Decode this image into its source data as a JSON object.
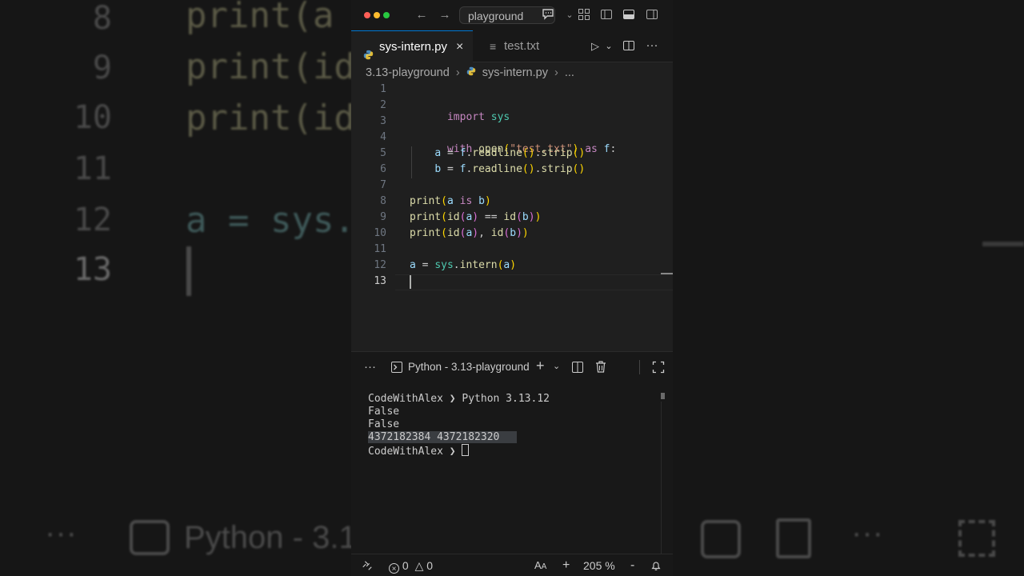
{
  "background": {
    "numbers": [
      "8",
      "9",
      "10",
      "11",
      "12",
      "13"
    ],
    "lines": [
      "print(a",
      "print(id",
      "print(id",
      "",
      "a = sys.",
      ""
    ],
    "bottom": {
      "dots": "···",
      "terminal": "Python - 3.1"
    }
  },
  "titlebar": {
    "search": "playground"
  },
  "tabs": [
    {
      "label": "sys-intern.py",
      "icon": "python-icon",
      "close": "×"
    },
    {
      "label": "test.txt",
      "icon": "text-file-icon"
    }
  ],
  "breadcrumb": {
    "folder": "3.13-playground",
    "file": "sys-intern.py",
    "more": "..."
  },
  "editor": {
    "line_numbers": [
      "1",
      "2",
      "3",
      "4",
      "5",
      "6",
      "7",
      "8",
      "9",
      "10",
      "11",
      "12",
      "13"
    ],
    "current_line": 13,
    "lines": [
      "",
      "import sys",
      "",
      "with open(\"test.txt\") as f:",
      "    a = f.readline().strip()",
      "    b = f.readline().strip()",
      "",
      "print(a is b)",
      "print(id(a) == id(b))",
      "print(id(a), id(b))",
      "",
      "a = sys.intern(a)",
      ""
    ]
  },
  "panel": {
    "more": "···",
    "terminal_name": "Python - 3.13-playground",
    "output": [
      "CodeWithAlex ❯ Python 3.13.12",
      "False",
      "False",
      "4372182384 4372182320",
      "CodeWithAlex ❯ "
    ]
  },
  "status": {
    "errors": "0",
    "warnings": "0",
    "font_size_icon": "A",
    "zoom": "205 %",
    "plus": "+",
    "minus": "-"
  },
  "colors": {
    "accent": "#0078d4",
    "keyword": "#c586c0",
    "function": "#dcdcaa",
    "string": "#ce9178",
    "variable": "#9cdcfe",
    "module": "#4ec9b0"
  }
}
